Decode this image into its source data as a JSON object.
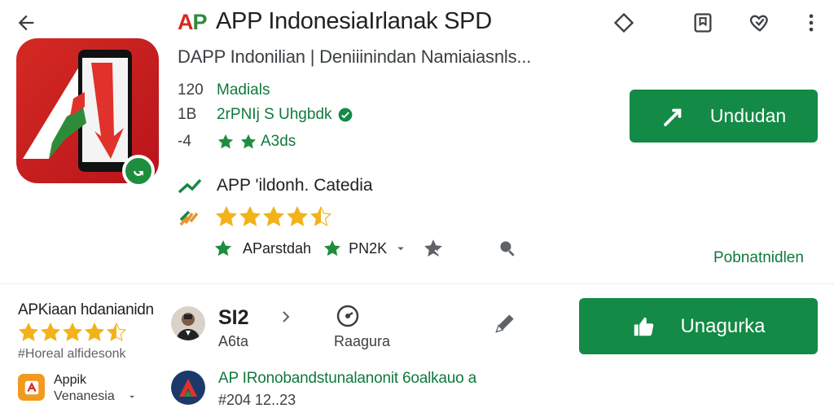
{
  "header": {
    "logo_text": "AP",
    "title": "APP IndonesiaIrlanak SPD",
    "subtitle": "DAPP Indonilian | Deniiinindan Namiaiasnls..."
  },
  "meta": {
    "row1": {
      "num": "120",
      "text": "Madials"
    },
    "row2": {
      "num": "1B",
      "text": "2rPNIj S Uhgbdk"
    },
    "row3": {
      "num": "-4",
      "text": "A3ds"
    }
  },
  "install_button": {
    "label": "Undudan"
  },
  "category": {
    "label": "APP 'ildonh. Catedia"
  },
  "rating": {
    "value": 4.5
  },
  "chips": {
    "chip1": "AParstdah",
    "chip2": "PN2K"
  },
  "link_right": "Pobnatnidlen",
  "section": {
    "title": "APKiaan hdanianidn",
    "rating": 4.5,
    "tag": "#Horeal alfidesonk",
    "small_app_name": "Appik",
    "small_app_region": "Venanesia"
  },
  "stats": {
    "main": "SI2",
    "sub": "A6ta",
    "rate_label": "Raagura"
  },
  "install_button_2": {
    "label": "Unagurka"
  },
  "developer": {
    "name": "AP IRonobandstunalanonit 6oalkauo a",
    "code": "#204 12..23"
  },
  "colors": {
    "accent_green": "#138a45",
    "brand_red": "#d42a23",
    "star_gold": "#f2b21a"
  }
}
